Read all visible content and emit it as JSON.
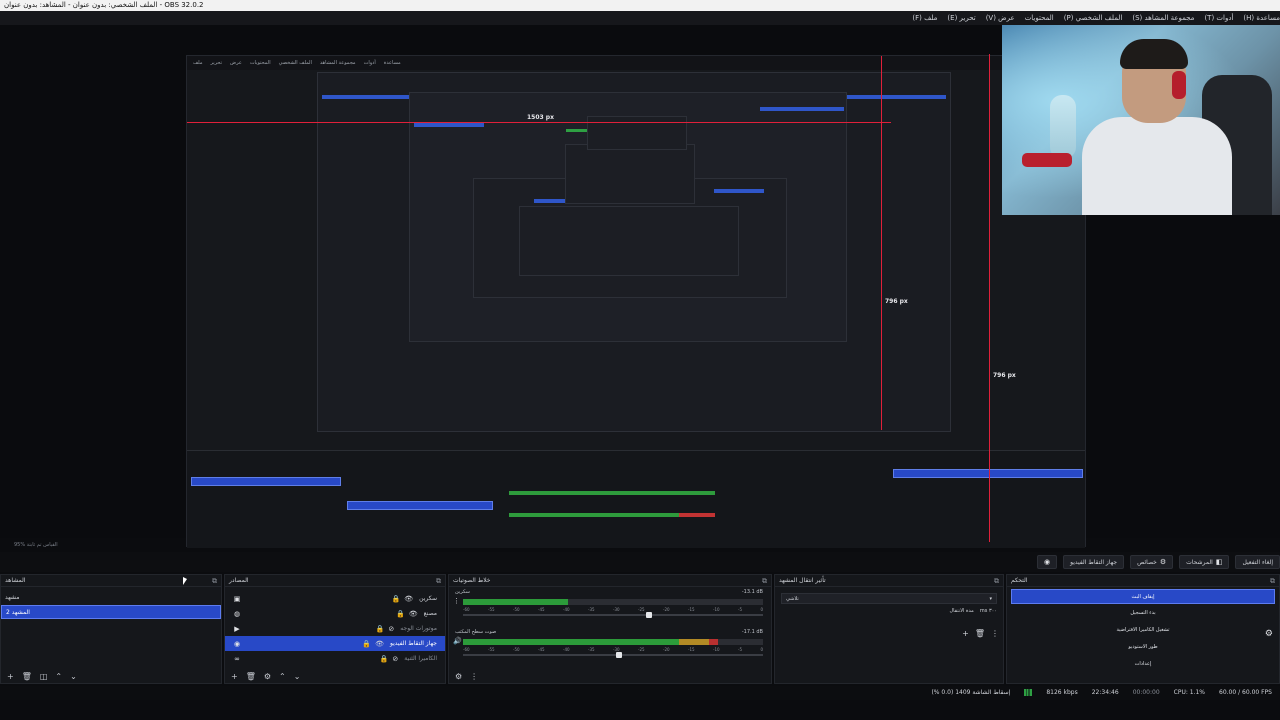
{
  "window": {
    "title": "OBS 32.0.2 - الملف الشخصي: بدون عنوان - المشاهد: بدون عنوان"
  },
  "menu": [
    "ملف (F)",
    "تحرير (E)",
    "عرض (V)",
    "المحتويات",
    "الملف الشخصي (P)",
    "مجموعة المشاهد (S)",
    "أدوات (T)",
    "مساعدة (H)"
  ],
  "preview": {
    "inner_menu": [
      "ملف",
      "تحرير",
      "عرض",
      "المحتويات",
      "الملف الشخصي",
      "مجموعة المشاهد",
      "أدوات",
      "مساعدة"
    ],
    "measure_top": "1503 px",
    "measure_right_small": "796 px",
    "measure_right": "796 px"
  },
  "scene_info": "95%   القياس تم ثابتة",
  "toolbar": {
    "source_label": "جهاز التقاط الفيديو",
    "properties": "خصائص",
    "filters": "المرشحات",
    "deactivate": "إلغاء التفعيل"
  },
  "scenes": {
    "title": "المشاهد",
    "items": [
      "مشهد",
      "المشهد 2"
    ],
    "selected": 1
  },
  "sources": {
    "title": "المصادر",
    "items": [
      {
        "name": "سكرين",
        "icon": "monitor-icon"
      },
      {
        "name": "مصنع",
        "icon": "web-icon"
      },
      {
        "name": "موتورات الوجه",
        "icon": "media-icon"
      },
      {
        "name": "جهاز التقاط الفيديو",
        "icon": "camera-icon",
        "selected": true
      },
      {
        "name": "الكاميرا الثنية",
        "icon": "link-icon"
      }
    ]
  },
  "mixer": {
    "title": "خلاط الصوتيات",
    "channels": [
      {
        "name": "سكرين",
        "db": "-13.1 dB",
        "level": 0.35,
        "fader": 0.62
      },
      {
        "name": "صوت سطح المكتب",
        "db": "-17.1 dB",
        "level": 0.85,
        "fader": 0.52
      }
    ],
    "scale": [
      "-60",
      "-55",
      "-50",
      "-45",
      "-40",
      "-35",
      "-30",
      "-25",
      "-20",
      "-15",
      "-10",
      "-5",
      "0"
    ]
  },
  "transitions": {
    "title": "تأثير انتقال المشهد",
    "selected": "تلاشي",
    "duration_label": "مدة الانتقال",
    "duration_value": "٣٠٠ ms"
  },
  "controls": {
    "title": "التحكم",
    "buttons": [
      "إيقاف البث",
      "بدء التسجيل",
      "تشغيل الكاميرا الافتراضية",
      "طور الاستوديو",
      "إعدادات"
    ]
  },
  "status": {
    "dropped": "إسقاط الشاشة 1409 (0.0 %)",
    "bitrate": "8126 kbps",
    "stream_time": "22:34:46",
    "rec_time": "00:00:00",
    "cpu": "CPU: 1.1%",
    "fps": "60.00 / 60.00 FPS"
  },
  "colors": {
    "accent": "#2849c7",
    "measure_line": "#e0203a",
    "meter_green": "#2c9b3a",
    "meter_red": "#b83030"
  }
}
